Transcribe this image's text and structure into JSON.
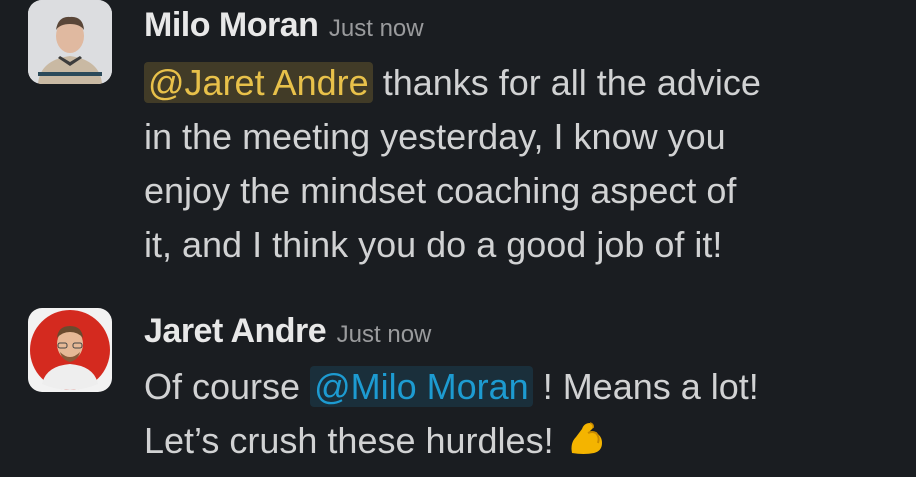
{
  "messages": [
    {
      "sender": "Milo Moran",
      "timestamp": "Just now",
      "mention": "@Jaret Andre",
      "lines": [
        "thanks for all the advice",
        "in the meeting yesterday, I know you",
        "enjoy the mindset coaching aspect of",
        "it, and I think you do a good job of it!"
      ]
    },
    {
      "sender": "Jaret Andre",
      "timestamp": "Just now",
      "before_mention": "Of course",
      "mention": "@Milo Moran",
      "after_mention": "! Means a lot!",
      "line2": "Let’s crush these hurdles!",
      "emoji": "flexed-biceps"
    }
  ],
  "colors": {
    "background": "#1a1d21",
    "text": "#d1d2d3",
    "mention_other": "#1d9bd1",
    "mention_self": "#e8c14a"
  }
}
